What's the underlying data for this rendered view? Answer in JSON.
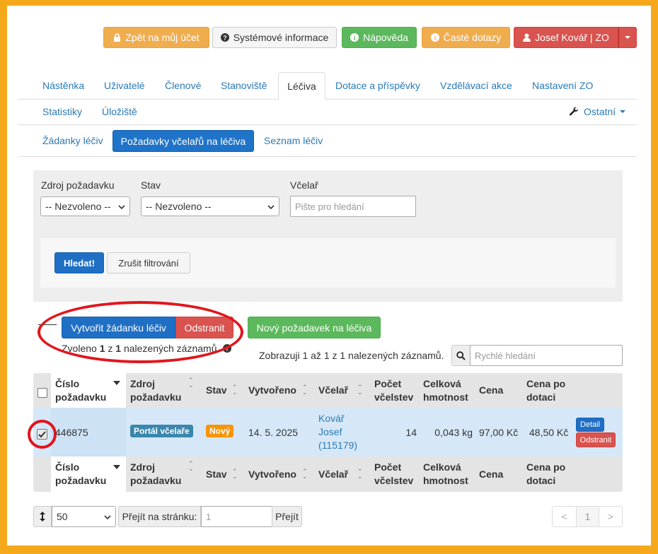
{
  "topbar": {
    "back_label": "Zpět na můj účet",
    "sysinfo_label": "Systémové informace",
    "help_label": "Nápověda",
    "faq_label": "Časté dotazy",
    "user_label": "Josef Kovář | ZO"
  },
  "nav": {
    "tabs": [
      "Nástěnka",
      "Uživatelé",
      "Členové",
      "Stanoviště",
      "Léčiva",
      "Dotace a příspěvky",
      "Vzdělávací akce",
      "Nastavení ZO",
      "Statistiky",
      "Úložiště"
    ],
    "other_label": "Ostatní"
  },
  "subnav": {
    "tabs": [
      "Žádanky léčiv",
      "Požadavky včelařů na léčiva",
      "Seznam léčiv"
    ]
  },
  "filter": {
    "source_label": "Zdroj požadavku",
    "source_value": "-- Nezvoleno --",
    "state_label": "Stav",
    "state_value": "-- Nezvoleno --",
    "beekeeper_label": "Včelař",
    "beekeeper_placeholder": "Pište pro hledání",
    "search_button": "Hledat!",
    "cancel_button": "Zrušit filtrování"
  },
  "actions": {
    "create_request": "Vytvořit žádanku léčiv",
    "delete": "Odstranit",
    "new_request": "Nový požadavek na léčiva",
    "selected_prefix": "Zvoleno ",
    "selected_count": "1",
    "selected_mid": " z ",
    "selected_total": "1",
    "selected_suffix": " nalezených záznamů",
    "showing": "Zobrazuji 1 až 1 z 1 nalezených záznamů.",
    "quick_search_placeholder": "Rychlé hledání"
  },
  "table": {
    "headers": {
      "number": "Číslo požadavku",
      "source": "Zdroj požadavku",
      "state": "Stav",
      "created": "Vytvořeno",
      "beekeeper": "Včelař",
      "colonies": "Počet včelstev",
      "weight": "Celková hmotnost",
      "price": "Cena",
      "price_subsidy": "Cena po dotaci"
    },
    "row": {
      "number": "446875",
      "source": "Portál včelaře",
      "state": "Nový",
      "created": "14. 5. 2025",
      "beekeeper": "Kovář Josef (115179)",
      "colonies": "14",
      "weight": "0,043 kg",
      "price": "97,00 Kč",
      "price_subsidy": "48,50 Kč",
      "detail_button": "Detail",
      "delete_button": "Odstranit"
    }
  },
  "pager": {
    "per_page": "50",
    "goto_label": "Přejít na stránku:",
    "goto_value": "1",
    "goto_button": "Přejít",
    "prev": "<",
    "current": "1",
    "next": ">"
  },
  "colors": {
    "frame": "#f5a81a",
    "annotation": "#e0161d",
    "primary": "#1f6fc5",
    "success": "#5cb85c",
    "danger": "#d9534f",
    "warning": "#f0ad4e",
    "badge_source": "#3a87ad",
    "badge_state": "#f89406"
  }
}
